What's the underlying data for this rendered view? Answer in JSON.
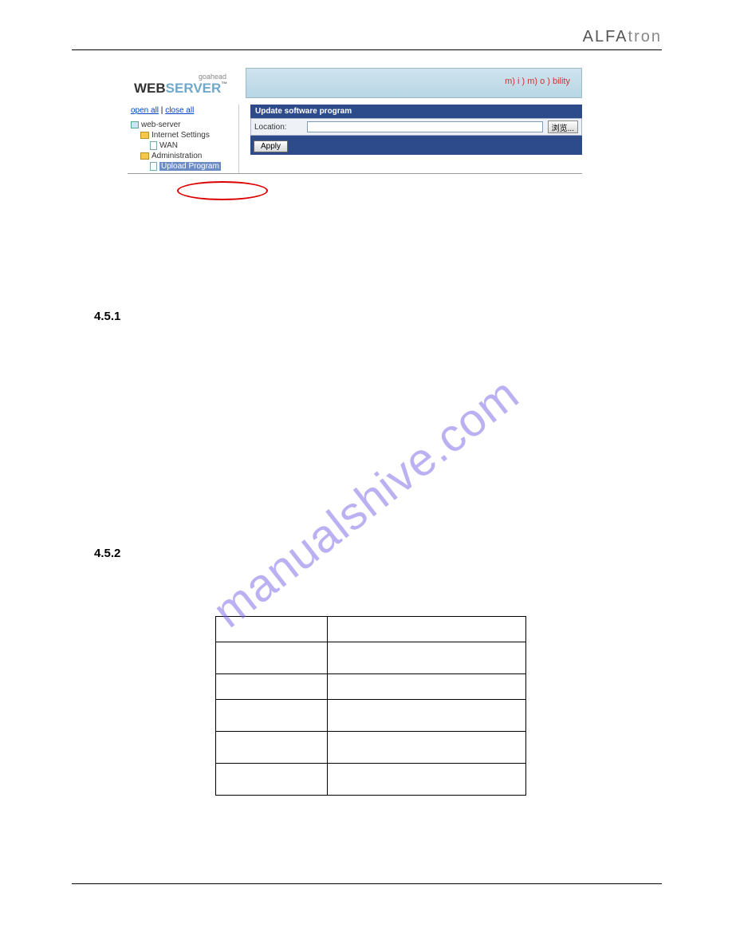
{
  "brand": {
    "part1": "ALFA",
    "part2": "tron"
  },
  "screenshot": {
    "logo": {
      "goahead": "goahead",
      "web": "WEB",
      "server": "SERVER",
      "tm": "™"
    },
    "mimo": {
      "text": "m) i ) m) o ) bility"
    },
    "tree_links": {
      "open": "open all",
      "sep": " | ",
      "close": "close all"
    },
    "tree": {
      "n0": "web-server",
      "n1": "Internet Settings",
      "n2": "WAN",
      "n3": "Administration",
      "n4": "Upload Program"
    },
    "panel": {
      "header": "Update software program",
      "location_label": "Location:",
      "browse_label": "浏览...",
      "apply_label": "Apply"
    }
  },
  "sections": {
    "s451": "4.5.1",
    "s452": "4.5.2"
  },
  "watermark": "manualshive.com"
}
